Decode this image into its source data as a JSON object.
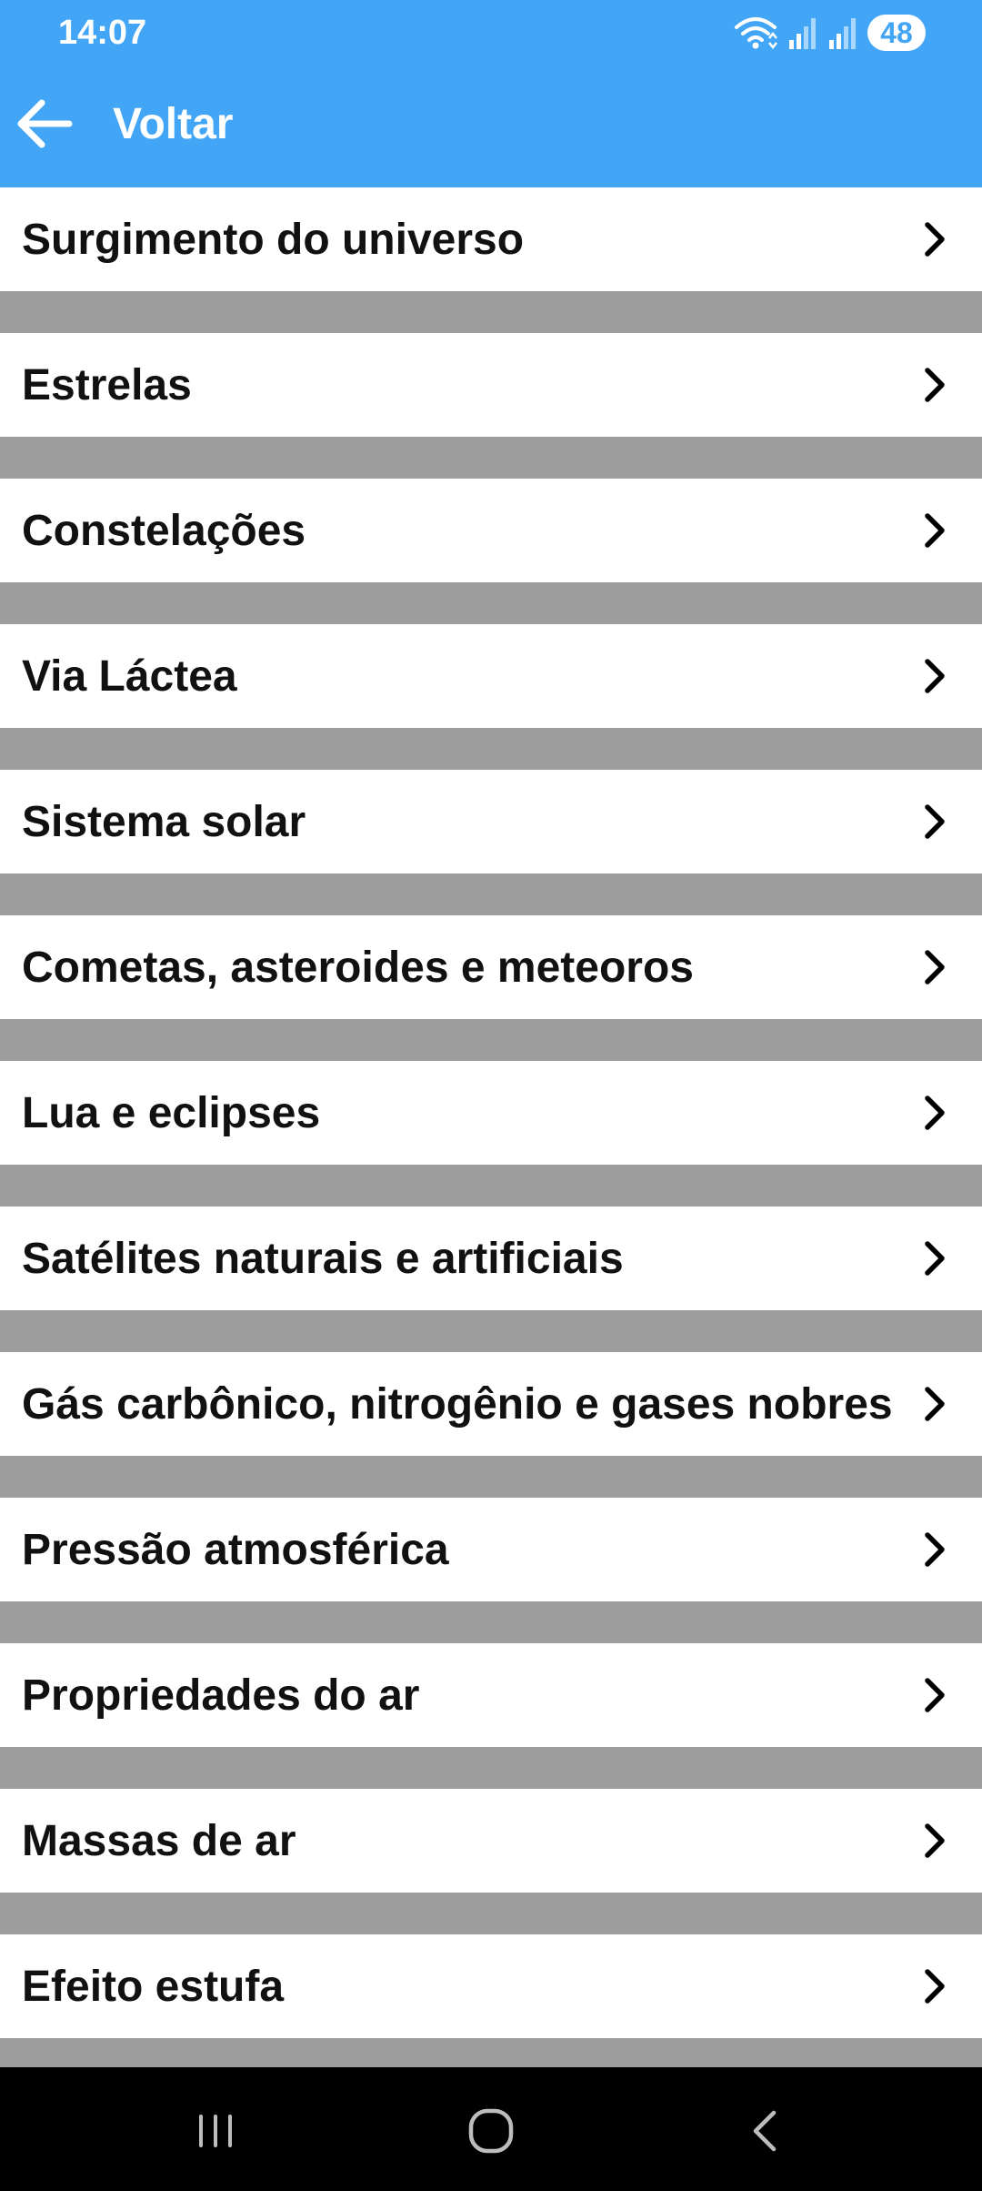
{
  "status_bar": {
    "time": "14:07",
    "battery": "48",
    "icons": [
      "wifi-icon",
      "signal-icon",
      "signal-icon",
      "battery-icon"
    ]
  },
  "app_bar": {
    "back_label": "Voltar",
    "back_icon": "arrow-back-icon",
    "color": "#42a5f5"
  },
  "list": {
    "items": [
      {
        "label": "Surgimento do universo"
      },
      {
        "label": "Estrelas"
      },
      {
        "label": "Constelações"
      },
      {
        "label": "Via Láctea"
      },
      {
        "label": "Sistema solar"
      },
      {
        "label": "Cometas, asteroides e meteoros"
      },
      {
        "label": "Lua e eclipses"
      },
      {
        "label": "Satélites naturais e artificiais"
      },
      {
        "label": "Gás carbônico, nitrogênio e gases nobres"
      },
      {
        "label": "Pressão atmosférica"
      },
      {
        "label": "Propriedades do ar"
      },
      {
        "label": "Massas de ar"
      },
      {
        "label": "Efeito estufa"
      }
    ],
    "item_icon": "chevron-right-icon",
    "separator_color": "#9e9e9e"
  },
  "nav_bar": {
    "buttons": [
      "recent-apps-icon",
      "home-icon",
      "back-icon"
    ]
  }
}
